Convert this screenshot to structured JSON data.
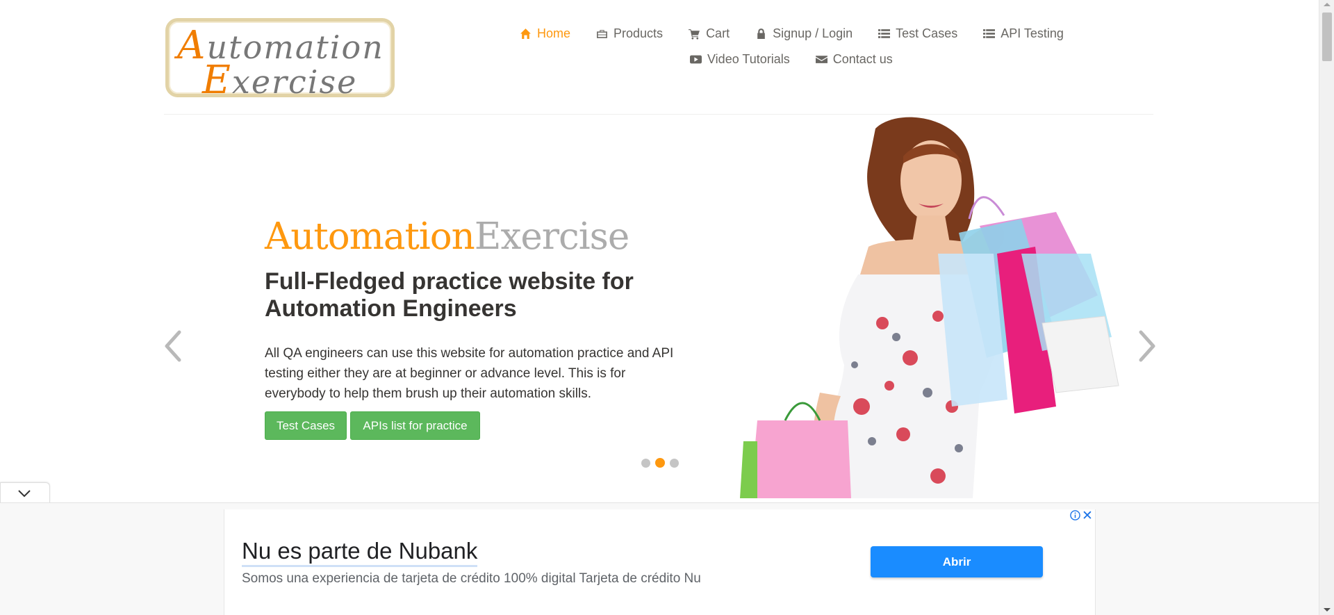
{
  "logo": {
    "line1_cap": "A",
    "line1_rest": "utomation",
    "line2_cap": "E",
    "line2_rest": "xercise"
  },
  "nav": {
    "items": [
      {
        "label": "Home",
        "icon": "home-icon",
        "active": true
      },
      {
        "label": "Products",
        "icon": "briefcase-icon"
      },
      {
        "label": "Cart",
        "icon": "cart-icon"
      },
      {
        "label": "Signup / Login",
        "icon": "lock-icon"
      },
      {
        "label": "Test Cases",
        "icon": "list-icon"
      },
      {
        "label": "API Testing",
        "icon": "list-icon"
      },
      {
        "label": "Video Tutorials",
        "icon": "youtube-play-icon"
      },
      {
        "label": "Contact us",
        "icon": "envelope-icon"
      }
    ]
  },
  "slider": {
    "title_part1": "Automation",
    "title_part2": "Exercise",
    "heading": "Full-Fledged practice website for Automation Engineers",
    "description": "All QA engineers can use this website for automation practice and API testing either they are at beginner or advance level. This is for everybody to help them brush up their automation skills.",
    "buttons": {
      "test_cases": "Test Cases",
      "apis": "APIs list for practice"
    },
    "active_slide": 2,
    "slide_count": 3
  },
  "ad": {
    "title": "Nu es parte de Nubank",
    "description": "Somos una experiencia de tarjeta de crédito 100% digital Tarjeta de crédito Nu",
    "cta": "Abrir",
    "close_glyph": "✕"
  },
  "colors": {
    "accent": "#fe980f",
    "button_green": "#5cb85c",
    "ad_button": "#1a8cff"
  }
}
